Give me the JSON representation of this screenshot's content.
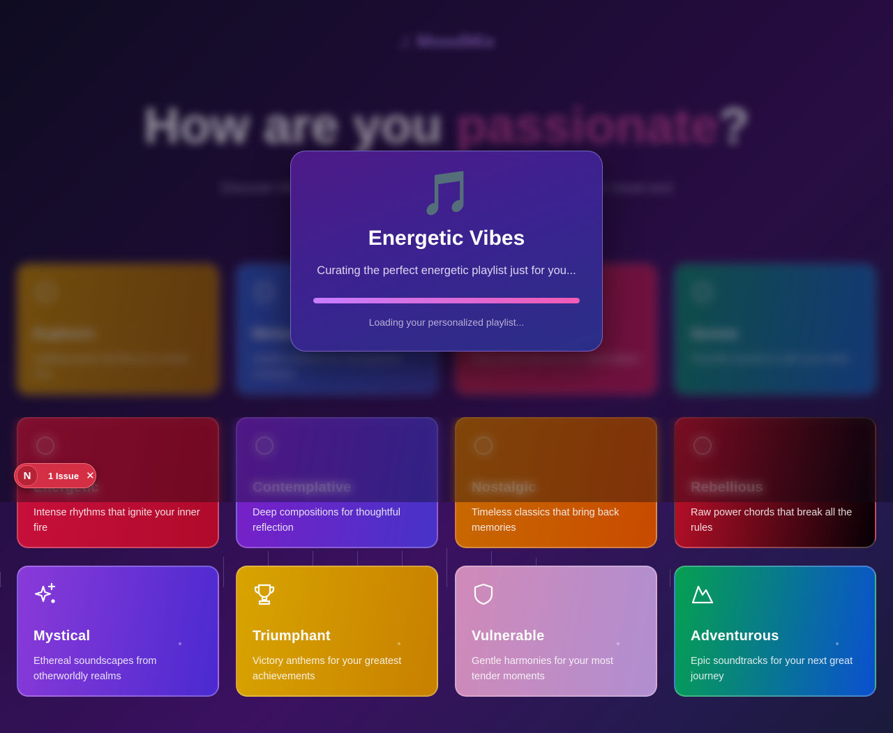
{
  "app": {
    "logo_text": "MoodMix"
  },
  "hero": {
    "part1": "How are you ",
    "part2": "passionate",
    "part3": "?"
  },
  "subtitle": {
    "line1": "Discover the perfect soundtrack for every feeling. Choose your mood and",
    "line2": "let the music find you."
  },
  "cards_top": [
    {
      "title": "Euphoric",
      "desc": "Uplifting beats that lift you to cloud nine",
      "color_a": "#c98a00",
      "color_b": "#a86400"
    },
    {
      "title": "Melancholic",
      "desc": "Soulful melodies for introspective moments",
      "color_a": "#2d59c8",
      "color_b": "#3b3fb0"
    },
    {
      "title": "Passionate",
      "desc": "Fiery tracks that set your heart ablaze",
      "color_a": "#c0224a",
      "color_b": "#c2185b"
    },
    {
      "title": "Serene",
      "desc": "Peaceful sounds to calm your mind",
      "color_a": "#0b8a6a",
      "color_b": "#1760c0"
    }
  ],
  "cards_middle": [
    {
      "title": "Energetic",
      "desc": "Intense rhythms that ignite your inner fire",
      "color_a": "#c8103c",
      "color_b": "#b00a2a"
    },
    {
      "title": "Contemplative",
      "desc": "Deep compositions for thoughtful reflection",
      "color_a": "#7a1fc8",
      "color_b": "#4633c8"
    },
    {
      "title": "Nostalgic",
      "desc": "Timeless classics that bring back memories",
      "color_a": "#c86a00",
      "color_b": "#c84a00"
    },
    {
      "title": "Rebellious",
      "desc": "Raw power chords that break all the rules",
      "color_a": "#c0102a",
      "color_b": "#050005"
    }
  ],
  "cards_bottom": [
    {
      "title": "Mystical",
      "desc": "Ethereal soundscapes from otherworldly realms",
      "icon": "sparkles-icon",
      "color_a": "#8a3ad8",
      "color_b": "#4a2ad0"
    },
    {
      "title": "Triumphant",
      "desc": "Victory anthems for your greatest achievements",
      "icon": "trophy-icon",
      "color_a": "#d8a400",
      "color_b": "#c88000"
    },
    {
      "title": "Vulnerable",
      "desc": "Gentle harmonies for your most tender moments",
      "icon": "shield-icon",
      "color_a": "#d08ab8",
      "color_b": "#b08ed0"
    },
    {
      "title": "Adventurous",
      "desc": "Epic soundtracks for your next great journey",
      "icon": "mountain-icon",
      "color_a": "#06a050",
      "color_b": "#0a50d0"
    }
  ],
  "modal": {
    "emoji": "🎵",
    "title": "Energetic Vibes",
    "text": "Curating the perfect energetic playlist just for you...",
    "progress": 1.0,
    "footer": "Loading your personalized playlist..."
  },
  "dev_overlay": {
    "badge": "N",
    "label": "1 Issue",
    "close": "✕"
  }
}
